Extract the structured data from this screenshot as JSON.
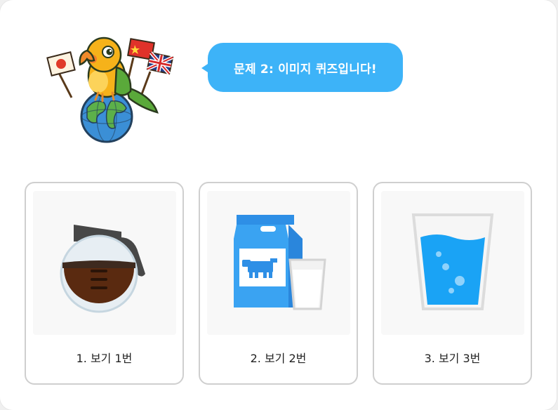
{
  "question": {
    "text": "문제 2: 이미지 퀴즈입니다!"
  },
  "colors": {
    "bubble": "#3db3f8",
    "card_border": "#cfcfcf"
  },
  "options": [
    {
      "label": "1. 보기 1번",
      "image": "coffee-pot-icon"
    },
    {
      "label": "2. 보기 2번",
      "image": "milk-carton-icon"
    },
    {
      "label": "3. 보기 3번",
      "image": "water-glass-icon"
    }
  ]
}
